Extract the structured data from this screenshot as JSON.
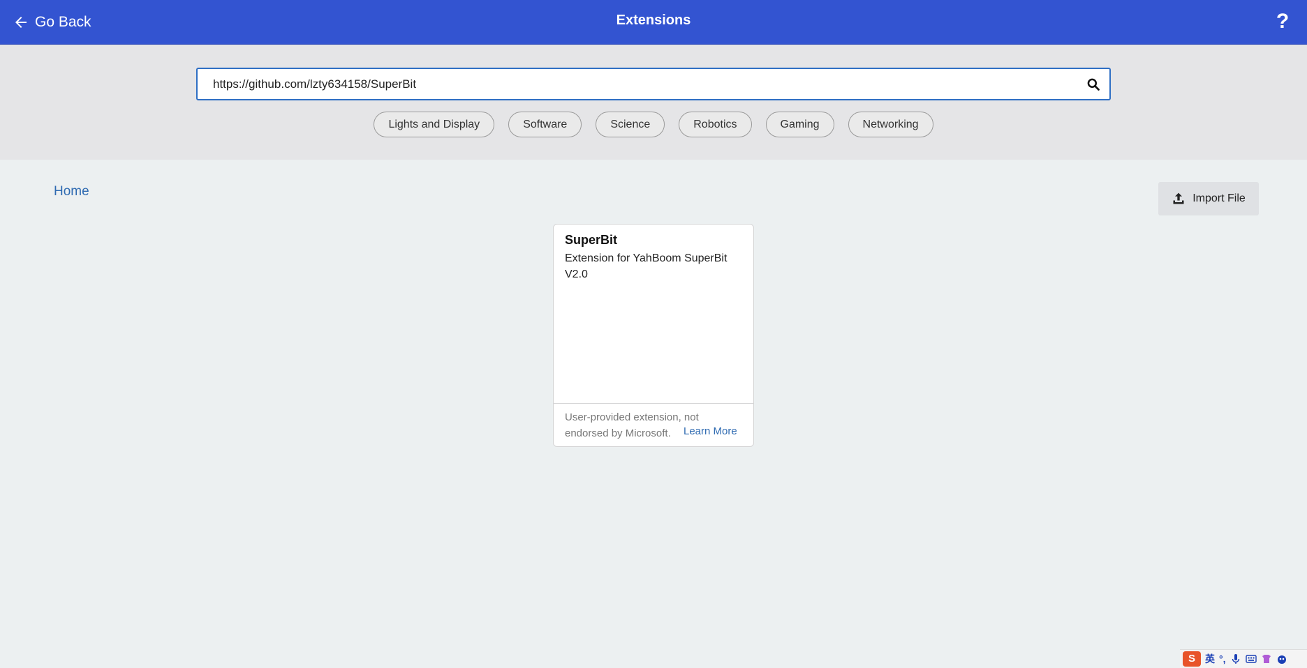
{
  "header": {
    "back_label": "Go Back",
    "title": "Extensions",
    "help_label": "?"
  },
  "search": {
    "value": "https://github.com/lzty634158/SuperBit"
  },
  "categories": [
    "Lights and Display",
    "Software",
    "Science",
    "Robotics",
    "Gaming",
    "Networking"
  ],
  "breadcrumb": {
    "home": "Home"
  },
  "import": {
    "label": "Import File"
  },
  "results": [
    {
      "title": "SuperBit",
      "description": "Extension for YahBoom SuperBit V2.0",
      "disclaimer": "User-provided extension, not endorsed by Microsoft.",
      "learn_more": "Learn More"
    }
  ],
  "ime": {
    "logo": "S",
    "mode": "英",
    "punct": "°,"
  },
  "colors": {
    "header_bg": "#3354d1",
    "link": "#2e6ab1",
    "search_border": "#2f6fc4"
  }
}
